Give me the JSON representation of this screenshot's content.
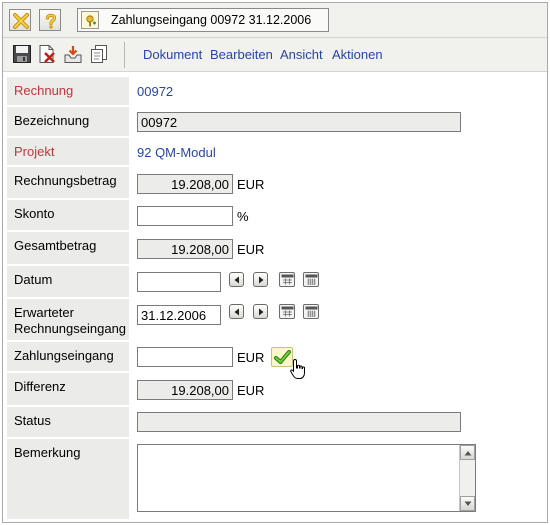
{
  "tab": {
    "title": "Zahlungseingang 00972 31.12.2006"
  },
  "menu": [
    "Dokument",
    "Bearbeiten",
    "Ansicht",
    "Aktionen"
  ],
  "form": {
    "rechnung": {
      "label": "Rechnung",
      "value": "00972"
    },
    "bezeichnung": {
      "label": "Bezeichnung",
      "value": "00972"
    },
    "projekt": {
      "label": "Projekt",
      "value": "92 QM-Modul"
    },
    "rechnungsbetrag": {
      "label": "Rechnungsbetrag",
      "value": "19.208,00",
      "unit": "EUR"
    },
    "skonto": {
      "label": "Skonto",
      "value": "",
      "unit": "%"
    },
    "gesamtbetrag": {
      "label": "Gesamtbetrag",
      "value": "19.208,00",
      "unit": "EUR"
    },
    "datum": {
      "label": "Datum",
      "value": ""
    },
    "erwarteter": {
      "label_line1": "Erwarteter",
      "label_line2": "Rechnungseingang",
      "value": "31.12.2006"
    },
    "zahlungseingang": {
      "label": "Zahlungseingang",
      "value": "",
      "unit": "EUR"
    },
    "differenz": {
      "label": "Differenz",
      "value": "19.208,00",
      "unit": "EUR"
    },
    "status": {
      "label": "Status",
      "value": ""
    },
    "bemerkung": {
      "label": "Bemerkung",
      "value": ""
    }
  },
  "icons": {
    "close": "close-x-icon",
    "help": "help-question-icon",
    "tab": "payment-document-icon",
    "save": "save-disk-icon",
    "delete": "delete-document-icon",
    "export": "export-tray-icon",
    "copy": "copy-documents-icon",
    "ok": "green-checkmark-icon"
  },
  "colors": {
    "link": "#2746a8",
    "required_label": "#c2353a",
    "label_bg": "#ebebea",
    "readonly_bg": "#ececea",
    "ok_button_bg": "#fdf7c8"
  }
}
